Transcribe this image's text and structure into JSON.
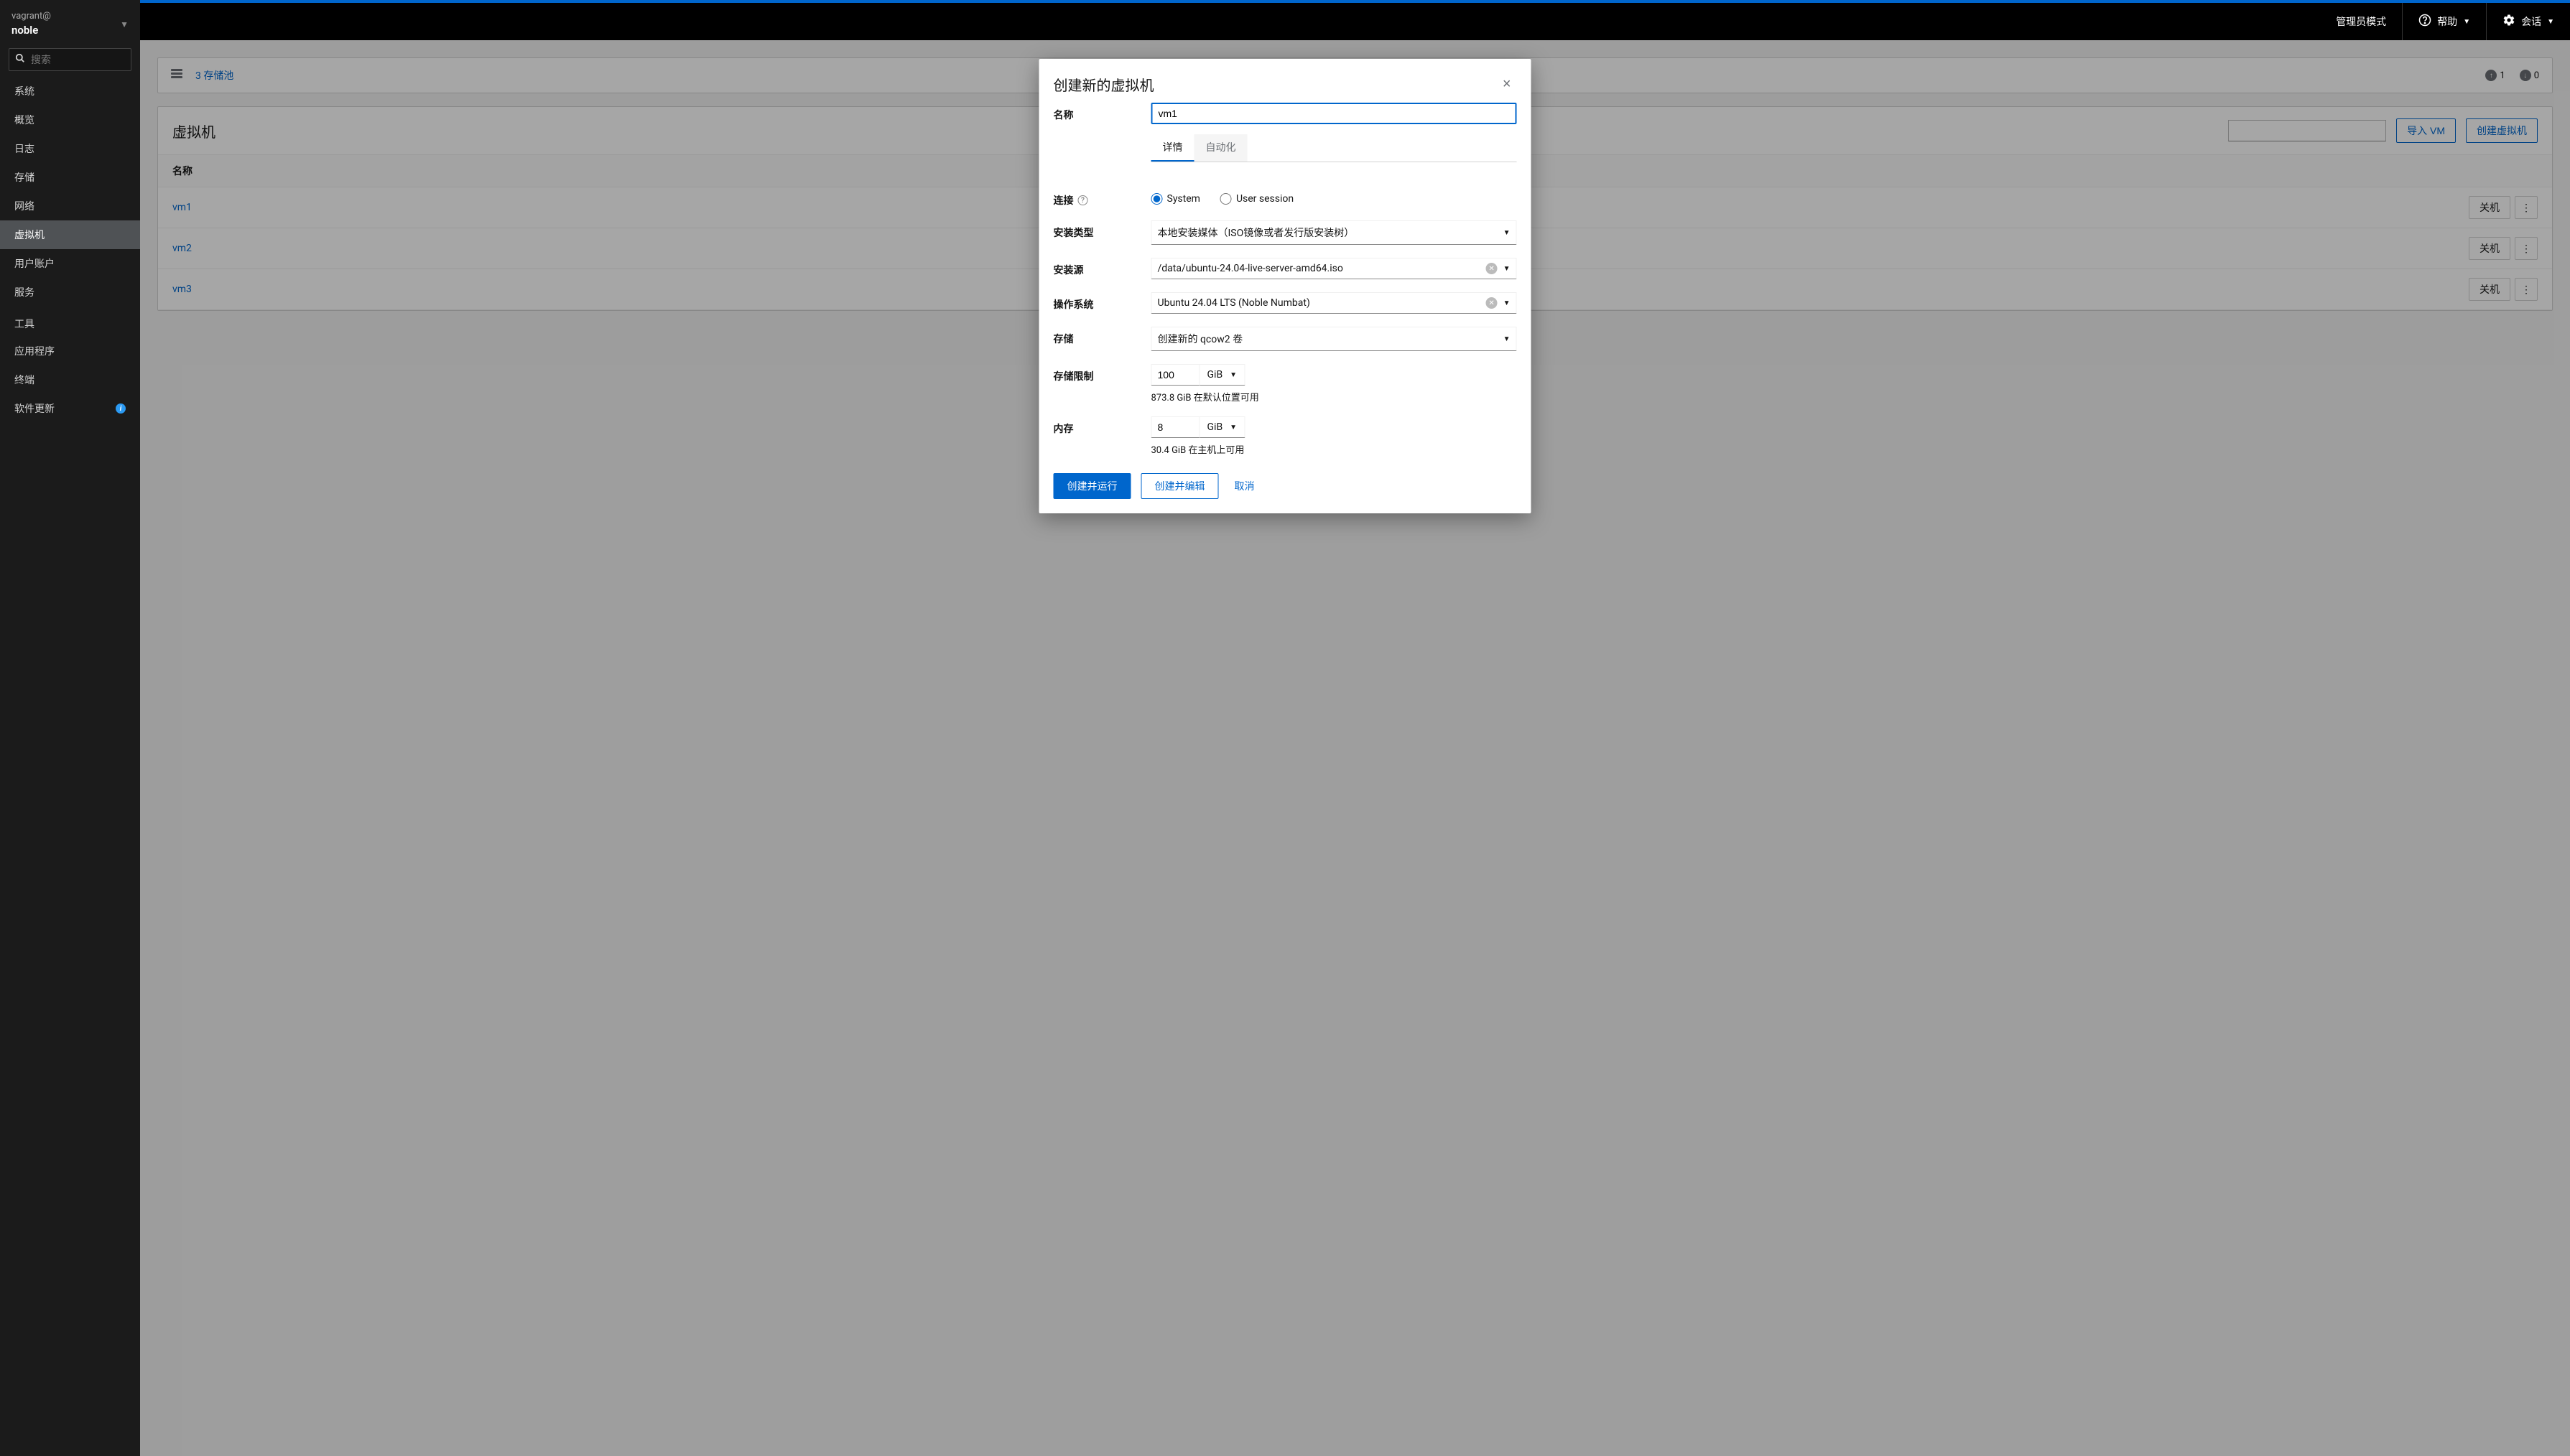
{
  "sidebar": {
    "user": "vagrant@",
    "host": "noble",
    "search_placeholder": "搜索",
    "items": [
      {
        "label": "系统"
      },
      {
        "label": "概览"
      },
      {
        "label": "日志"
      },
      {
        "label": "存储"
      },
      {
        "label": "网络"
      },
      {
        "label": "虚拟机"
      },
      {
        "label": "用户账户"
      },
      {
        "label": "服务"
      }
    ],
    "tools_label": "工具",
    "tools": [
      {
        "label": "应用程序"
      },
      {
        "label": "终端"
      },
      {
        "label": "软件更新",
        "badge": true
      }
    ]
  },
  "topbar": {
    "admin_mode": "管理员模式",
    "help": "帮助",
    "session": "会话"
  },
  "pool": {
    "link": "3 存储池",
    "net_up": "1",
    "net_down": "0"
  },
  "vm": {
    "title": "虚拟机",
    "filter_placeholder": "",
    "import_btn": "导入 VM",
    "create_btn": "创建虚拟机",
    "col_name": "名称",
    "shutdown": "关机",
    "rows": [
      {
        "name": "vm1"
      },
      {
        "name": "vm2"
      },
      {
        "name": "vm3"
      }
    ]
  },
  "modal": {
    "title": "创建新的虚拟机",
    "name_label": "名称",
    "name_value": "vm1",
    "tab_details": "详情",
    "tab_auto": "自动化",
    "conn_label": "连接",
    "conn_system": "System",
    "conn_user": "User session",
    "install_type_label": "安装类型",
    "install_type_value": "本地安装媒体（ISO镜像或者发行版安装树）",
    "install_src_label": "安装源",
    "install_src_value": "/data/ubuntu-24.04-live-server-amd64.iso",
    "os_label": "操作系统",
    "os_value": "Ubuntu 24.04 LTS (Noble Numbat)",
    "storage_label": "存储",
    "storage_value": "创建新的 qcow2 卷",
    "storage_limit_label": "存储限制",
    "storage_limit_value": "100",
    "storage_limit_unit": "GiB",
    "storage_limit_hint": "873.8 GiB 在默认位置可用",
    "memory_label": "内存",
    "memory_value": "8",
    "memory_unit": "GiB",
    "memory_hint": "30.4 GiB 在主机上可用",
    "btn_create_run": "创建并运行",
    "btn_create_edit": "创建并编辑",
    "btn_cancel": "取消"
  }
}
